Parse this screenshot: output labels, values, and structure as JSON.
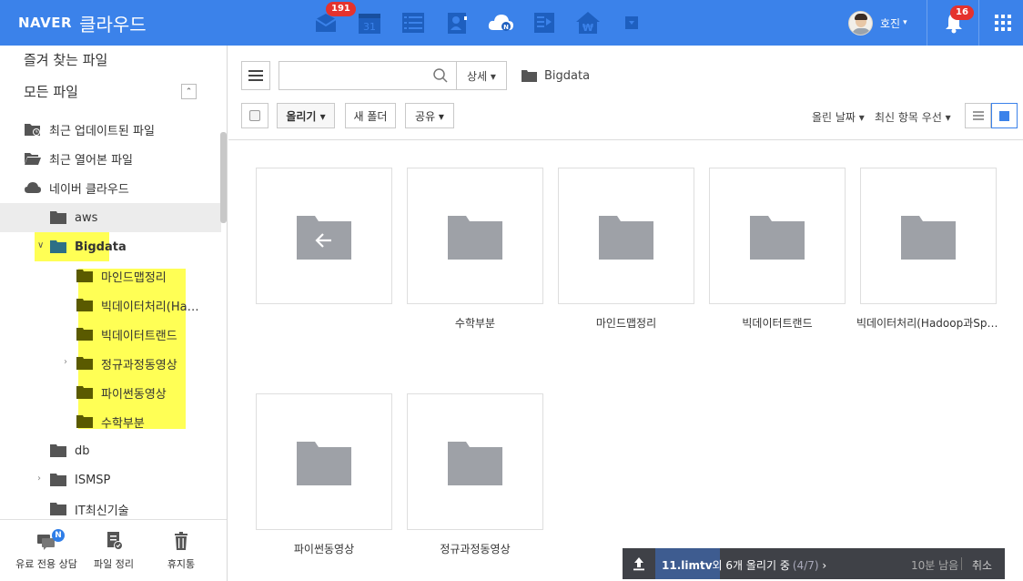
{
  "header": {
    "brand": "NAVER",
    "service": "클라우드",
    "mail_badge": "191",
    "calendar_day": "31",
    "user_name": "호진",
    "notification_badge": "16",
    "apps": [
      "mail-icon",
      "calendar-icon",
      "list-icon",
      "contacts-icon",
      "cloud-icon",
      "memo-icon",
      "household-icon",
      "more-icon"
    ],
    "accent": "#3b82ea"
  },
  "sidebar": {
    "favorites": "즐겨 찾는 파일",
    "all_files": "모든 파일",
    "collapse": "⌃",
    "recent_updated": "최근 업데이트된 파일",
    "recent_opened": "최근 열어본 파일",
    "naver_cloud": "네이버 클라우드",
    "tree": {
      "aws": "aws",
      "bigdata": "Bigdata",
      "children": [
        "마인드맵정리",
        "빅데이터처리(Ha…",
        "빅데이터트랜드",
        "정규과정동영상",
        "파이썬동영상",
        "수학부분"
      ],
      "db": "db",
      "ismsp": "ISMSP",
      "it": "IT최신기술"
    },
    "footer": {
      "consult": "유료 전용 상담",
      "consult_badge": "N",
      "organize": "파일 정리",
      "trash": "휴지통"
    }
  },
  "toolbar": {
    "search_placeholder": "",
    "detail": "상세 ▾",
    "breadcrumb": "Bigdata",
    "upload": "올리기 ▾",
    "new_folder": "새 폴더",
    "share": "공유 ▾",
    "sort_date": "올린 날짜 ▾",
    "sort_order": "최신 항목 우선 ▾"
  },
  "folders": [
    {
      "label": ""
    },
    {
      "label": "수학부분"
    },
    {
      "label": "마인드맵정리"
    },
    {
      "label": "빅데이터트랜드"
    },
    {
      "label": "빅데이터처리(Hadoop과Spark)"
    },
    {
      "label": "파이썬동영상"
    },
    {
      "label": "정규과정동영상"
    }
  ],
  "upload_status": {
    "file": "11.limtv",
    "message": "외 6개 올리기 중",
    "count": "(4/7)",
    "chevron": "›",
    "remaining": "10분 남음",
    "cancel": "취소",
    "progress": 0.17
  }
}
